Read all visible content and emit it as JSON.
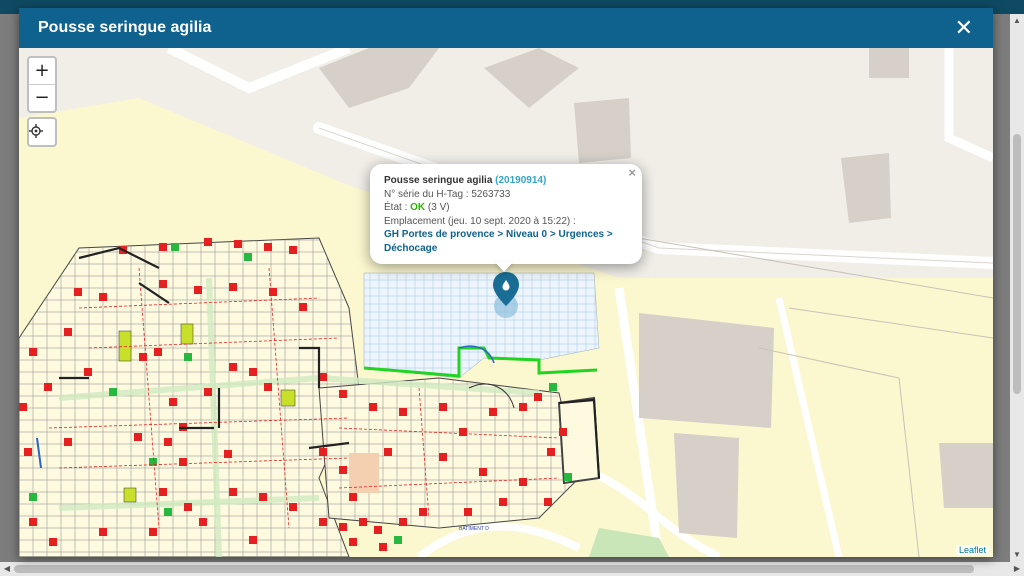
{
  "modal": {
    "title": "Pousse seringue agilia",
    "close_glyph": "✕"
  },
  "map_controls": {
    "zoom_in": "+",
    "zoom_out": "−",
    "locate_icon": "crosshair-icon"
  },
  "popup": {
    "device_name": "Pousse seringue agilia",
    "device_id": "(20190914)",
    "serial_label": "N° série du H-Tag :",
    "serial_value": "5263733",
    "state_label": "État :",
    "state_value": "OK",
    "state_detail": "(3 V)",
    "location_label": "Emplacement",
    "location_time": "(jeu. 10 sept. 2020 à 15:22) :",
    "location_path": "GH Portes de provence > Niveau 0 > Urgences > Déchocage",
    "close_glyph": "×"
  },
  "map": {
    "building_label": "BATIMENT D",
    "attribution": "Leaflet",
    "marker_color": "#1a6e96"
  },
  "colors": {
    "header": "#0f628e",
    "topbar": "#0f4a63",
    "floorplan_zone": "#fbf7cf",
    "highlight_green": "#22d422",
    "equipment_red": "#e62020"
  }
}
